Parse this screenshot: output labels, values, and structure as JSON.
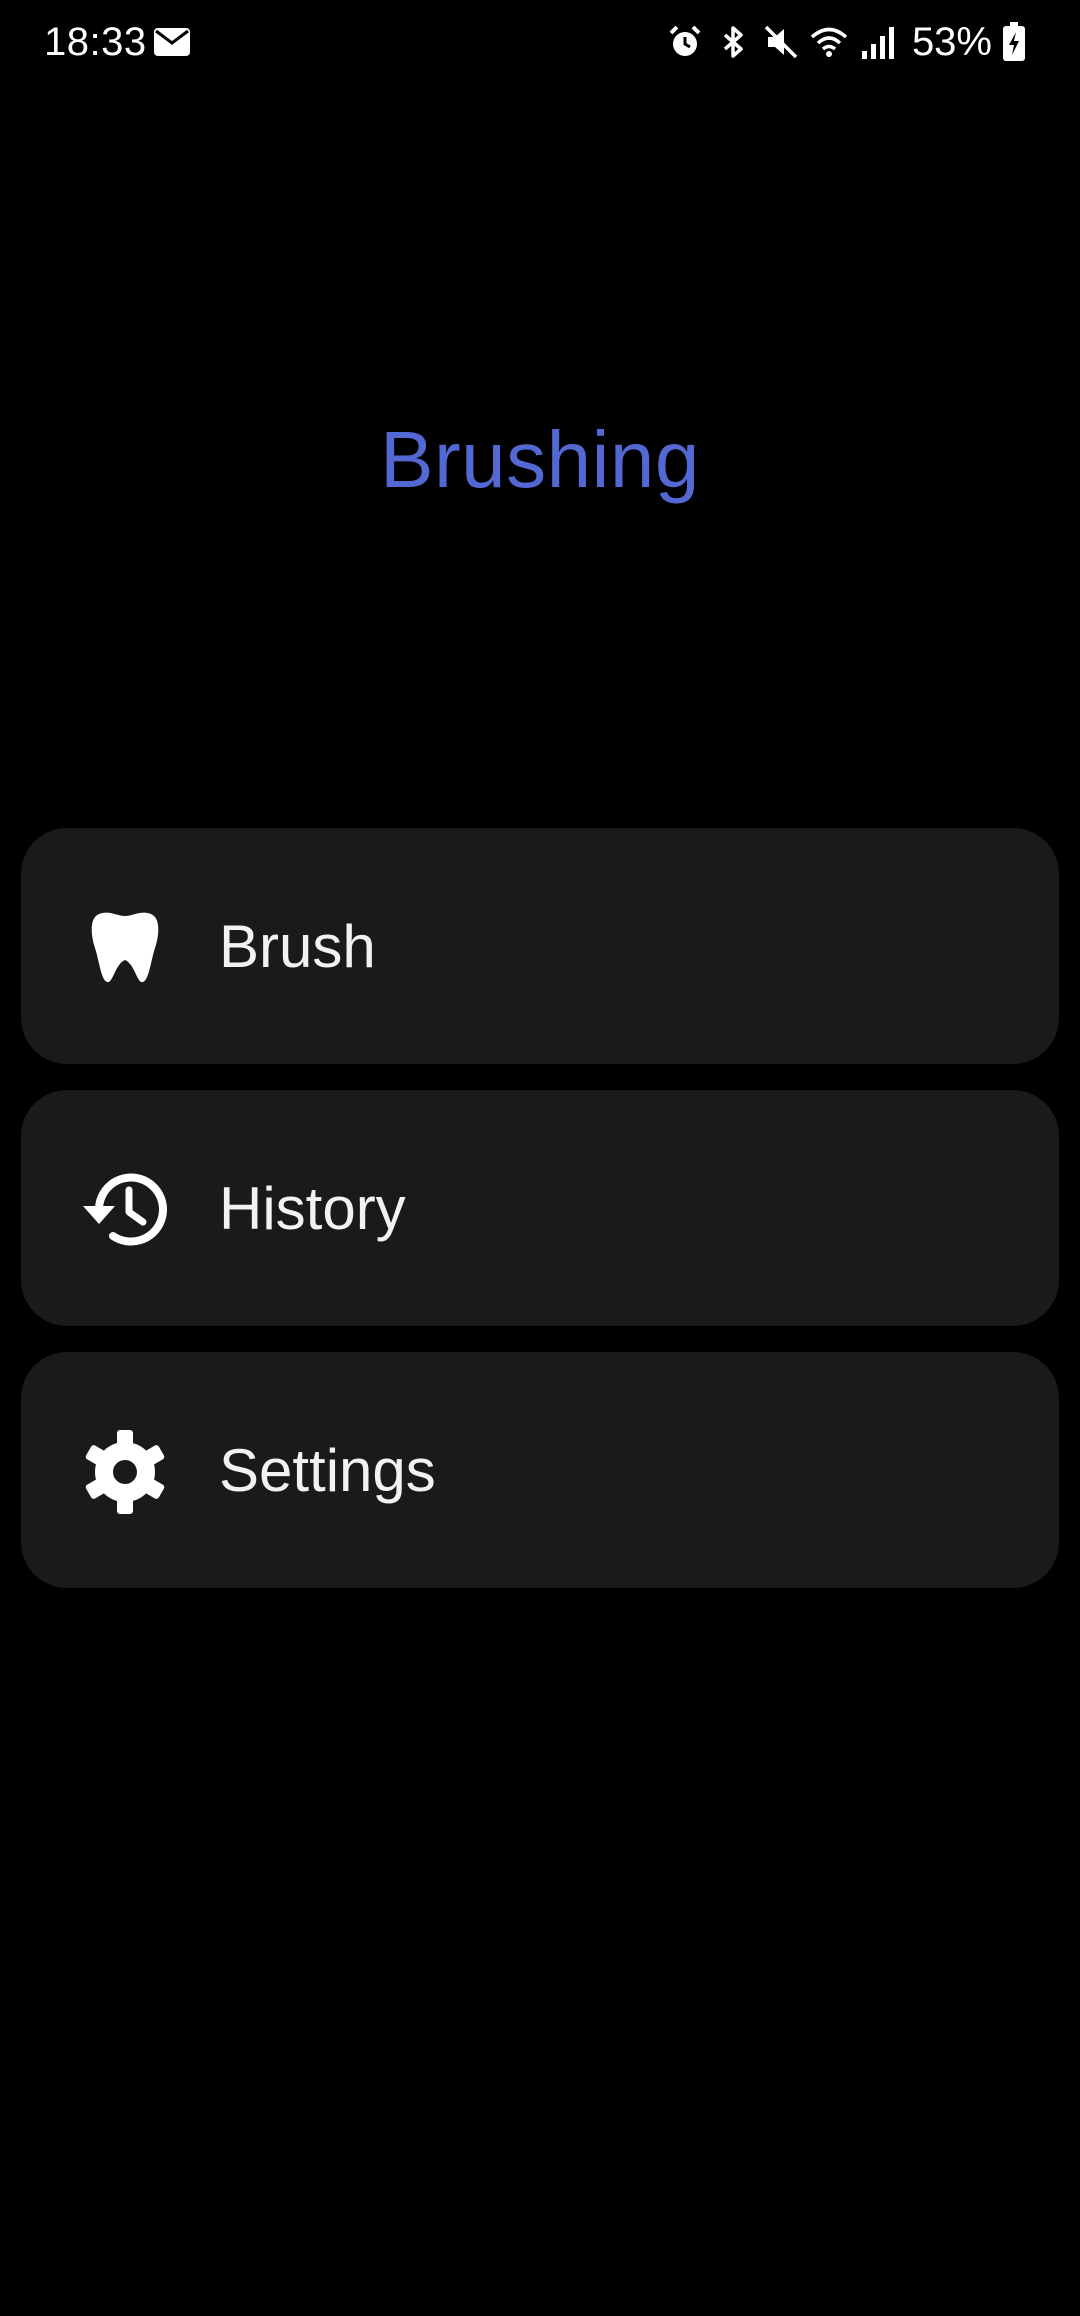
{
  "status_bar": {
    "time": "18:33",
    "battery": "53%",
    "left_icons": [
      "mail-icon"
    ],
    "right_icons": [
      "alarm-icon",
      "bluetooth-icon",
      "mute-icon",
      "wifi-icon",
      "signal-icon",
      "battery-charging-icon"
    ]
  },
  "app": {
    "title": "Brushing",
    "accent_color": "#5468d4"
  },
  "menu": {
    "items": [
      {
        "id": "brush",
        "label": "Brush",
        "icon": "tooth-icon"
      },
      {
        "id": "history",
        "label": "History",
        "icon": "history-icon"
      },
      {
        "id": "settings",
        "label": "Settings",
        "icon": "gear-icon"
      }
    ]
  },
  "colors": {
    "background": "#000000",
    "card": "#1a1a1a",
    "text": "#f2f2f2"
  }
}
